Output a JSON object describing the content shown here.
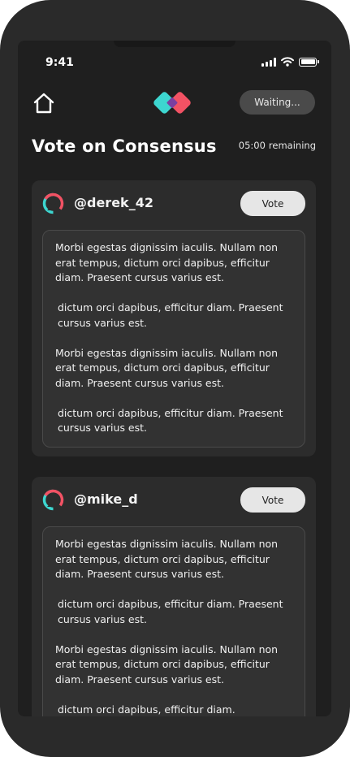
{
  "status_bar": {
    "time": "9:41"
  },
  "header": {
    "status_pill": "Waiting...",
    "title": "Vote on Consensus",
    "timer": "05:00",
    "timer_suffix": "remaining"
  },
  "colors": {
    "logo_cyan": "#3dd6d0",
    "logo_red": "#f25264",
    "logo_purple": "#7b3fa0",
    "background": "#1f1f1f",
    "card": "#2c2c2c"
  },
  "icons": {
    "home": "home-icon",
    "logo": "app-logo",
    "avatar": "avatar-ring"
  },
  "posts": [
    {
      "username": "@derek_42",
      "vote_label": "Vote",
      "paragraphs": [
        "Morbi egestas dignissim iaculis. Nullam non erat tempus, dictum orci dapibus, efficitur diam. Praesent cursus varius est.",
        "dictum orci dapibus, efficitur diam. Praesent cursus varius est.",
        "Morbi egestas dignissim iaculis. Nullam non erat tempus, dictum orci dapibus, efficitur diam. Praesent cursus varius est.",
        "dictum orci dapibus, efficitur diam. Praesent cursus varius est."
      ]
    },
    {
      "username": "@mike_d",
      "vote_label": "Vote",
      "paragraphs": [
        "Morbi egestas dignissim iaculis. Nullam non erat tempus, dictum orci dapibus, efficitur diam. Praesent cursus varius est.",
        "dictum orci dapibus, efficitur diam. Praesent cursus varius est.",
        "Morbi egestas dignissim iaculis. Nullam non erat tempus, dictum orci dapibus, efficitur diam. Praesent cursus varius est.",
        "dictum orci dapibus, efficitur diam."
      ]
    }
  ]
}
